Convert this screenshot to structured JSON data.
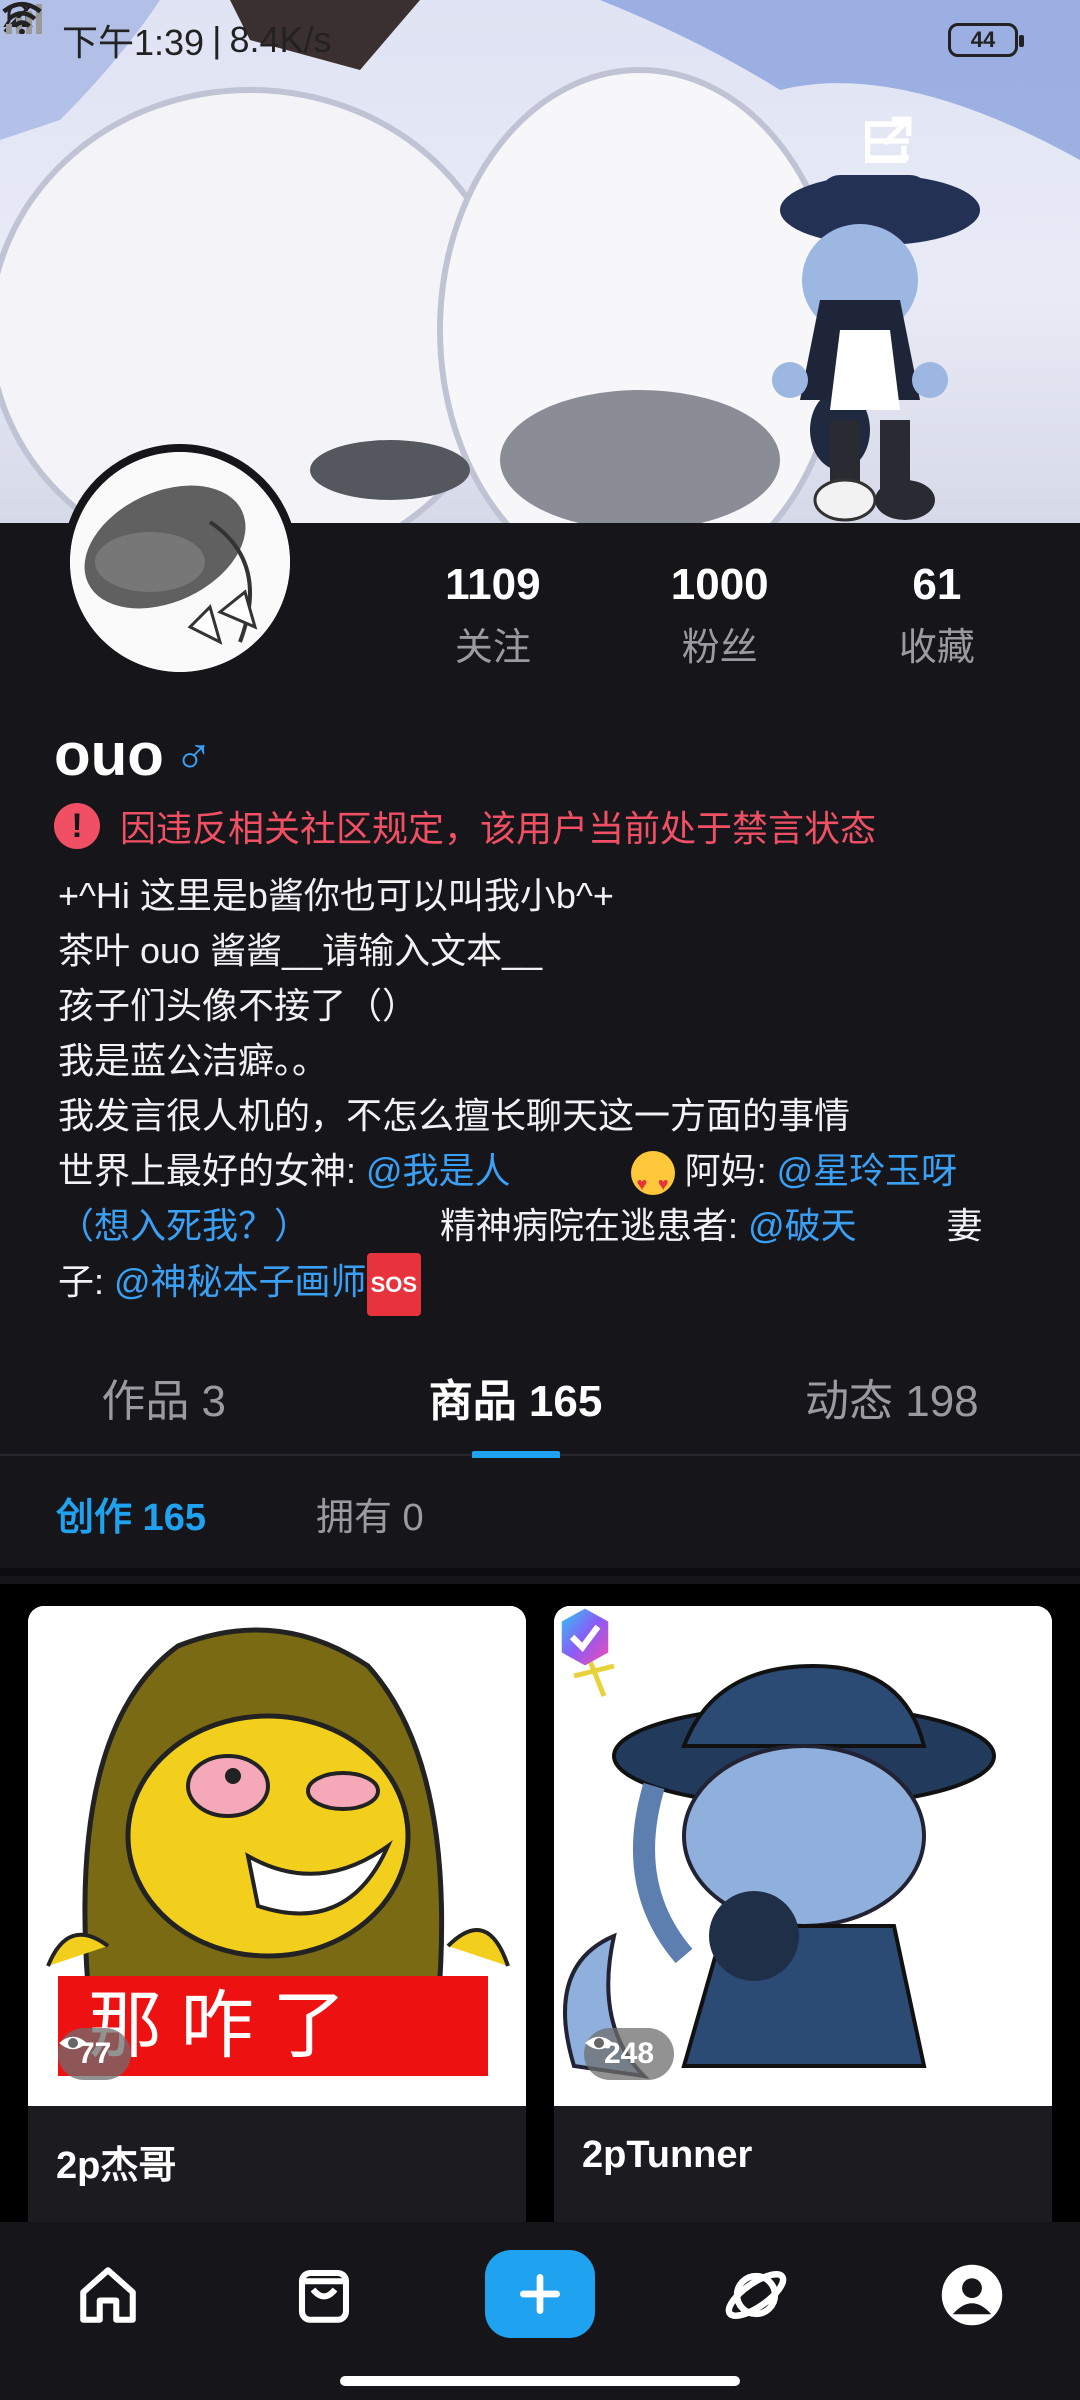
{
  "status_bar": {
    "time": "下午1:39",
    "separator": "|",
    "net_speed": "8.4K/s",
    "battery": "44"
  },
  "profile": {
    "stats": [
      {
        "value": "1109",
        "label": "关注"
      },
      {
        "value": "1000",
        "label": "粉丝"
      },
      {
        "value": "61",
        "label": "收藏"
      }
    ],
    "username": "ouo",
    "gender_symbol": "♂",
    "warning": "因违反相关社区规定，该用户当前处于禁言状态",
    "bio": {
      "line1": "+^Hi 这里是b酱你也可以叫我小b^+",
      "line2": " 茶叶 ouo 酱酱__请输入文本__",
      "line3": " 孩子们头像不接了（）",
      "line4": " 我是蓝公洁癖。。",
      "line5": " 我发言很人机的，不怎么擅长聊天这一方面的事情",
      "line6_text": " 世界上最好的女神: ",
      "line6_mention": "@我是人",
      "line6_text2": " 阿妈: ",
      "line6_mention2": "@星玲玉呀",
      "line7_mention": "（想入死我？）",
      "line7_text": "精神病院在逃患者: ",
      "line7_mention2": "@破天",
      "line7_text2": "妻",
      "line8_text": "子: ",
      "line8_mention": "@神秘本子画师",
      "sos": "SOS"
    }
  },
  "tabs": [
    {
      "label": "作品 3"
    },
    {
      "label": "商品 165"
    },
    {
      "label": "动态 198"
    }
  ],
  "subtabs": [
    {
      "label": "创作 165"
    },
    {
      "label": "拥有 0"
    }
  ],
  "products": [
    {
      "title": "2p杰哥",
      "views": "77",
      "image_text": "那咋了"
    },
    {
      "title": "2pTunner",
      "views": "248"
    }
  ],
  "colors": {
    "accent": "#1fa3f1",
    "warning": "#f04f64",
    "background": "#16161a",
    "mention": "#3aa0f5"
  },
  "icons": {
    "nav": [
      "home-icon",
      "shop-bag-icon",
      "add-icon",
      "planet-icon",
      "profile-icon"
    ],
    "top": [
      "share-icon",
      "menu-icon"
    ]
  }
}
